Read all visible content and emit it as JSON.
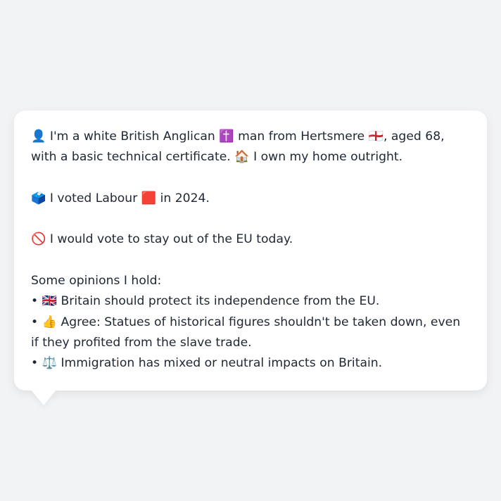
{
  "persona": {
    "intro_icon": "👤",
    "intro_a": " I'm a white British Anglican ",
    "religion_icon": "✝️",
    "intro_b": " man from Hertsmere ",
    "flag_icon": "🏴󠁧󠁢󠁥󠁮󠁧󠁿",
    "intro_c": ", aged 68, with a basic technical certificate. ",
    "home_icon": "🏠",
    "intro_d": " I own my home outright."
  },
  "vote": {
    "ballot_icon": "🗳️",
    "text_a": " I voted Labour ",
    "party_icon": "🟥",
    "text_b": " in 2024."
  },
  "eu": {
    "no_icon": "🚫",
    "text": " I would vote to stay out of the EU today."
  },
  "opinions": {
    "heading": "Some opinions I hold:",
    "bullet": "•",
    "items": [
      {
        "icon": "🇬🇧",
        "text": " Britain should protect its independence from the EU."
      },
      {
        "icon": "👍",
        "text": " Agree: Statues of historical figures shouldn't be taken down, even if they profited from the slave trade."
      },
      {
        "icon": "⚖️",
        "text": " Immigration has mixed or neutral impacts on Britain."
      }
    ]
  }
}
